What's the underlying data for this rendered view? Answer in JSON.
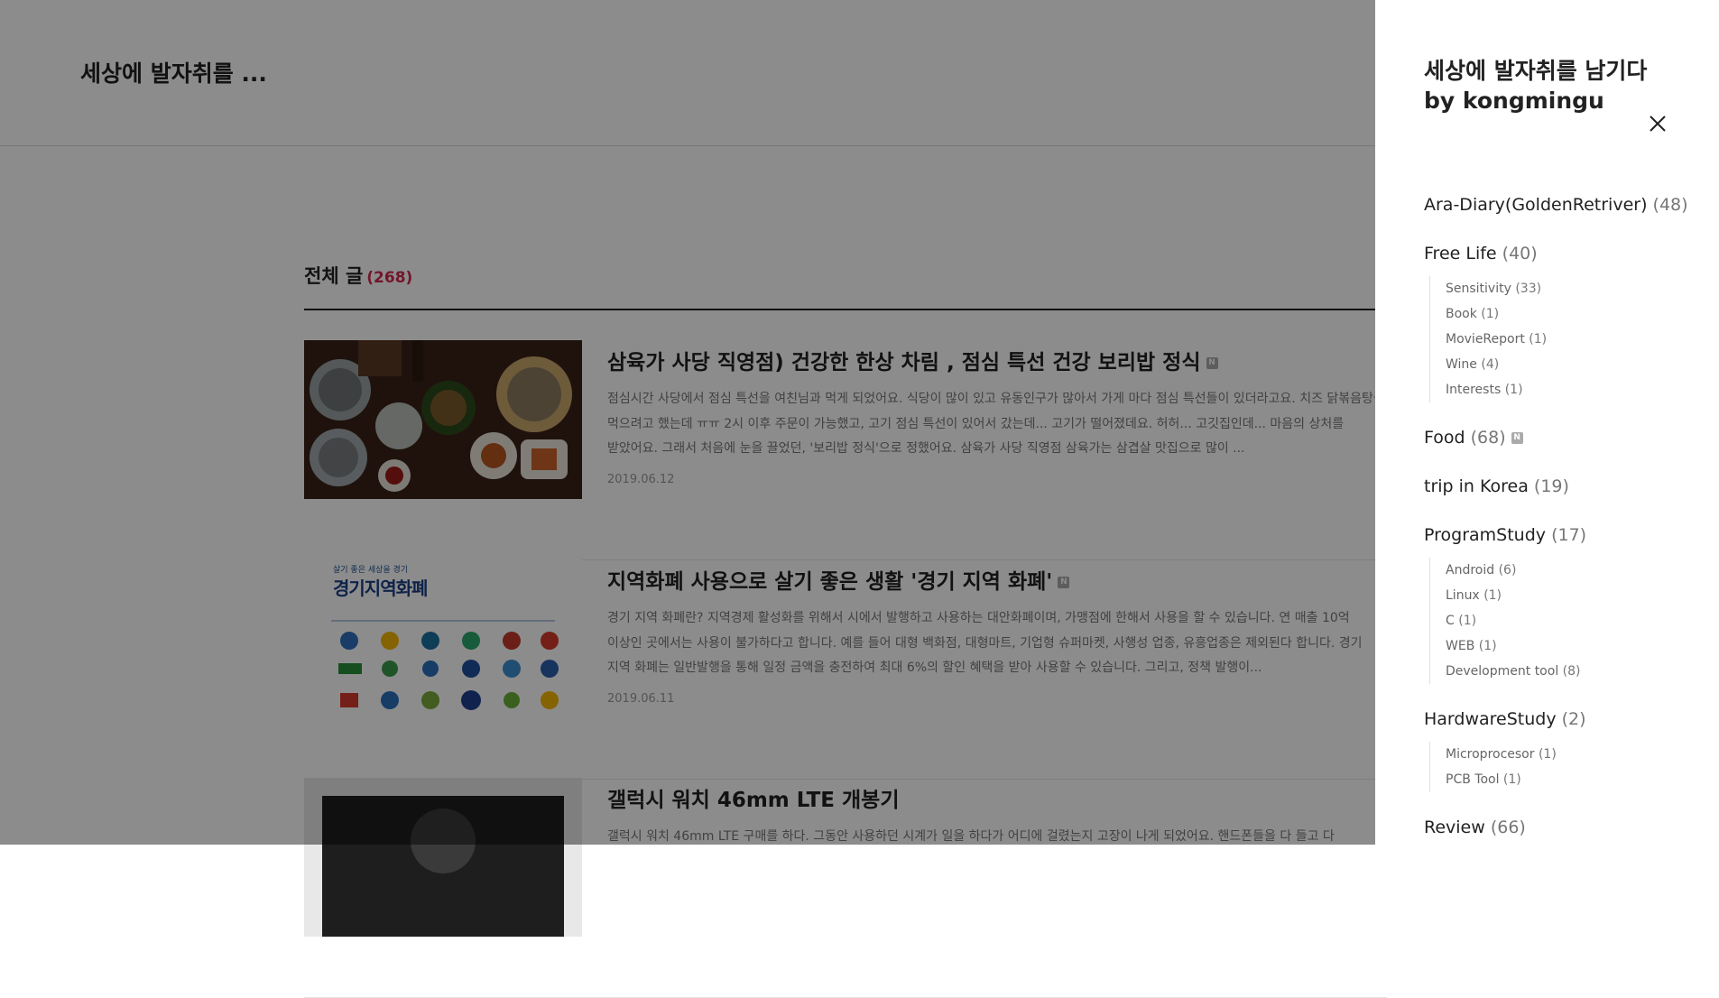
{
  "blog": {
    "title": "세상에 발자취를 ..."
  },
  "list": {
    "title": "전체 글",
    "count": "(268)"
  },
  "posts": [
    {
      "title": "삼육가 사당 직영점) 건강한 한상 차림 , 점심 특선 건강 보리밥 정식",
      "badge": "N",
      "excerpt": "점심시간 사당에서 점심 특선을 여친님과 먹게 되었어요. 식당이 많이 있고 유동인구가 많아서 가게 마다 점심 특선들이 있더라고요. 치즈 닭볶음탕을 먹으려고 했는데 ㅠㅠ 2시 이후 주문이 가능했고, 고기 점심 특선이 있어서 갔는데... 고기가 떨어졌데요. 허허... 고깃집인데... 마음의 상처를 받았어요. 그래서 처음에 눈을 끌었던, '보리밥 정식'으로 정했어요. 삼육가 사당 직영점 삼육가는 삼겹살 맛집으로 많이 ...",
      "date": "2019.06.12"
    },
    {
      "title": "지역화폐 사용으로 살기 좋은 생활 '경기 지역 화폐'",
      "badge": "N",
      "excerpt": "경기 지역 화폐란? 지역경제 활성화를 위해서 시에서 발행하고 사용하는 대안화폐이며, 가맹점에 한해서 사용을 할 수 있습니다. 연 매출 10억 이상인 곳에서는 사용이 불가하다고 합니다. 예를 들어 대형 백화점, 대형마트, 기업형 슈퍼마켓, 사행성 업종, 유흥업종은 제외된다 합니다. 경기 지역 화폐는 일반발행을 통해 일정 금액을 충전하여 최대 6%의 할인 혜택을 받아 사용할 수 있습니다. 그리고, 정책 발행이...",
      "date": "2019.06.11",
      "thumb": {
        "tagline": "살기 좋은 세상을 경기",
        "heading": "경기지역화폐"
      }
    },
    {
      "title": "갤럭시 워치 46mm LTE 개봉기",
      "badge": "",
      "excerpt": "갤럭시 워치 46mm LTE 구매를 하다. 그동안 사용하던 시계가 일을 하다가 어디에 걸렸는지 고장이 나게 되었어요. 핸드폰들을 다 들고 다",
      "date": ""
    }
  ],
  "drawer": {
    "title_line1": "세상에 발자취를 남기다",
    "title_line2": "by kongmingu",
    "categories": [
      {
        "name": "Ara-Diary(GoldenRetriver)",
        "count": "(48)"
      },
      {
        "name": "Free Life",
        "count": "(40)",
        "subs": [
          {
            "name": "Sensitivity",
            "count": "(33)"
          },
          {
            "name": "Book",
            "count": "(1)"
          },
          {
            "name": "MovieReport",
            "count": "(1)"
          },
          {
            "name": "Wine",
            "count": "(4)"
          },
          {
            "name": "Interests",
            "count": "(1)"
          }
        ]
      },
      {
        "name": "Food",
        "count": "(68)",
        "badge": "N"
      },
      {
        "name": "trip in Korea",
        "count": "(19)"
      },
      {
        "name": "ProgramStudy",
        "count": "(17)",
        "subs": [
          {
            "name": "Android",
            "count": "(6)"
          },
          {
            "name": "Linux",
            "count": "(1)"
          },
          {
            "name": "C",
            "count": "(1)"
          },
          {
            "name": "WEB",
            "count": "(1)"
          },
          {
            "name": "Development tool",
            "count": "(8)"
          }
        ]
      },
      {
        "name": "HardwareStudy",
        "count": "(2)",
        "subs": [
          {
            "name": "Microprocesor",
            "count": "(1)"
          },
          {
            "name": "PCB Tool",
            "count": "(1)"
          }
        ]
      },
      {
        "name": "Review",
        "count": "(66)"
      }
    ]
  },
  "colors": {
    "accent": "#d0284d",
    "overlay": "rgba(0,0,0,0.45)"
  },
  "icons": {
    "close": "close-icon"
  }
}
